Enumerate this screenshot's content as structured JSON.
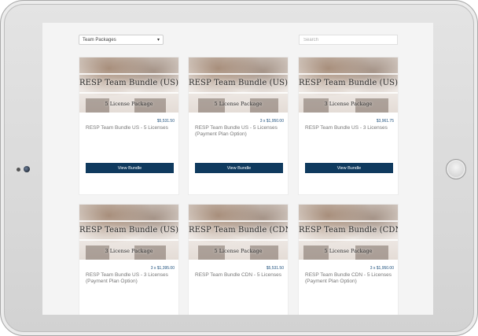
{
  "filter": {
    "selected": "Team Packages"
  },
  "search": {
    "placeholder": "Search"
  },
  "products": [
    {
      "image_title": "RESP Team Bundle (US)",
      "image_subtitle": "5 License Package",
      "price": "$5,531.50",
      "name": "RESP Team Bundle US - 5 Licenses",
      "button": "View Bundle"
    },
    {
      "image_title": "RESP Team Bundle (US)",
      "image_subtitle": "5 License Package",
      "price": "3 x $1,950.00",
      "name": "RESP Team Bundle US - 5 Licenses (Payment Plan Option)",
      "button": "View Bundle"
    },
    {
      "image_title": "RESP Team Bundle (US)",
      "image_subtitle": "3 License Package",
      "price": "$3,961.75",
      "name": "RESP Team Bundle US - 3 Licenses",
      "button": "View Bundle"
    },
    {
      "image_title": "RESP Team Bundle (US)",
      "image_subtitle": "3 License Package",
      "price": "3 x $1,395.00",
      "name": "RESP Team Bundle US - 3 Licenses (Payment Plan Option)",
      "button": ""
    },
    {
      "image_title": "RESP Team Bundle (CDN)",
      "image_subtitle": "5 License Package",
      "price": "$5,531.50",
      "name": "RESP Team Bundle CDN - 5 Licenses",
      "button": ""
    },
    {
      "image_title": "RESP Team Bundle (CDN)",
      "image_subtitle": "5 License Package",
      "price": "3 x $1,950.00",
      "name": "RESP Team Bundle CDN - 5 Licenses (Payment Plan Option)",
      "button": ""
    }
  ]
}
